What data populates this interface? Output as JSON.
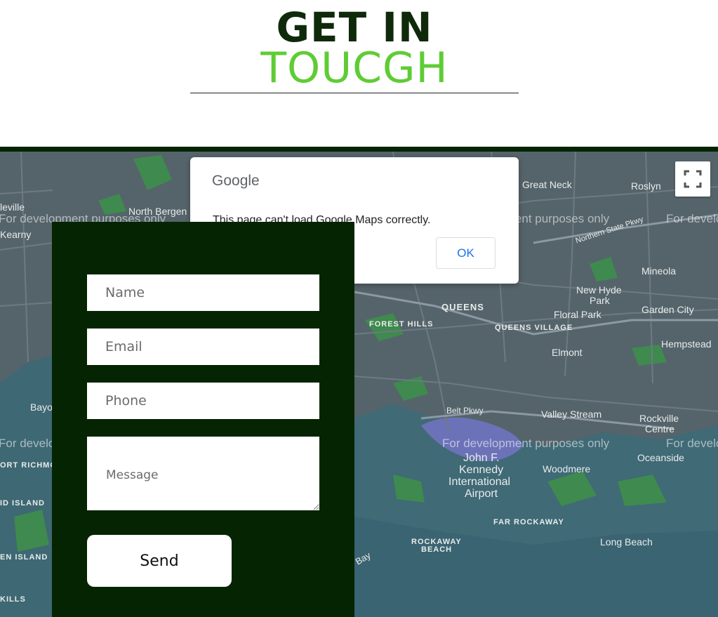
{
  "header": {
    "title_line1": "GET IN",
    "title_line2": "TOUCGH"
  },
  "colors": {
    "dark_green": "#052402",
    "accent_green": "#5fcc34",
    "map_bg": "#4a5a60"
  },
  "map": {
    "watermark": "For development purposes only",
    "labels": {
      "great_neck": "Great Neck",
      "roslyn": "Roslyn",
      "north_bergen": "North Bergen",
      "kearny": "Kearny",
      "leville": "leville",
      "queens": "QUEENS",
      "forest_hills": "FOREST HILLS",
      "queens_village": "QUEENS VILLAGE",
      "mineola": "Mineola",
      "new_hyde_park_1": "New Hyde",
      "new_hyde_park_2": "Park",
      "floral_park": "Floral Park",
      "garden_city": "Garden City",
      "elmont": "Elmont",
      "hempstead": "Hempstead",
      "belt_pkwy": "Belt Pkwy",
      "valley_stream": "Valley Stream",
      "rockville_1": "Rockville",
      "rockville_2": "Centre",
      "oceanside": "Oceanside",
      "jfk_1": "John F.",
      "jfk_2": "Kennedy",
      "jfk_3": "International",
      "jfk_4": "Airport",
      "woodmere": "Woodmere",
      "far_rockaway": "FAR ROCKAWAY",
      "rockaway_beach_1": "ROCKAWAY",
      "rockaway_beach_2": "BEACH",
      "long_beach": "Long Beach",
      "bayo": "Bayo",
      "ort_richmo": "ORT RICHMO",
      "id_island": "ID ISLAND",
      "en_island": "EN ISLAND",
      "kills": "KILLS",
      "northern_state_pkwy": "Northern State Pkwy",
      "bay": "Bay"
    },
    "fullscreen_icon": "fullscreen-icon"
  },
  "dialog": {
    "logo": "Google",
    "message": "This page can't load Google Maps correctly.",
    "ok_label": "OK"
  },
  "form": {
    "name_placeholder": "Name",
    "email_placeholder": "Email",
    "phone_placeholder": "Phone",
    "message_placeholder": "Message",
    "send_label": "Send"
  }
}
